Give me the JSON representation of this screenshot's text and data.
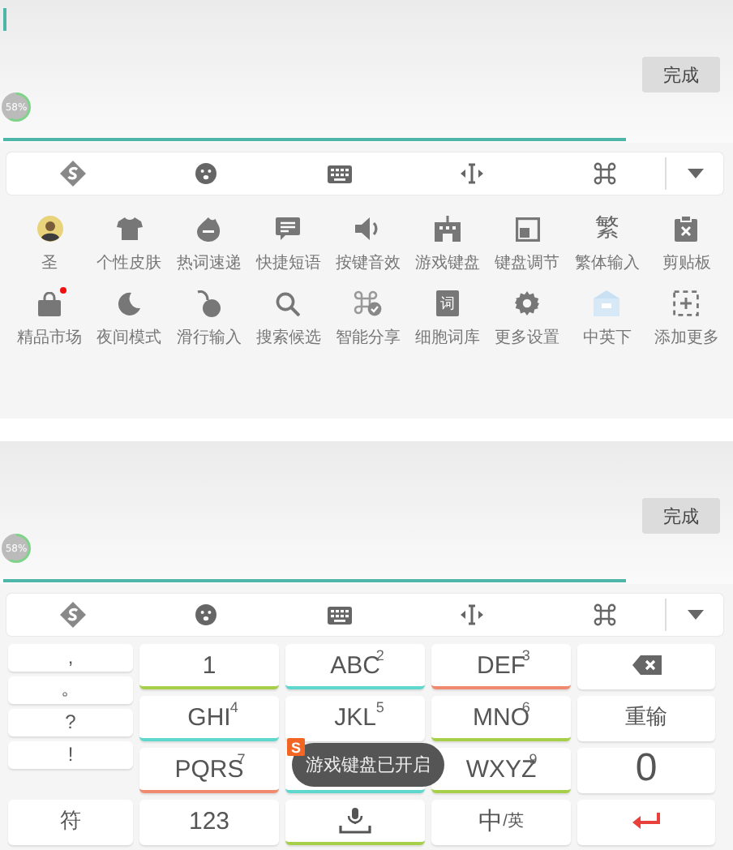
{
  "panels": [
    {
      "kind": "functions",
      "editor": {
        "cursor": true,
        "done_button": "完成",
        "progress": {
          "text": "58%"
        }
      },
      "functions": [
        {
          "label": "圣",
          "new_dot": false
        },
        {
          "label": "个性皮肤",
          "new_dot": false
        },
        {
          "label": "热词速递",
          "new_dot": false
        },
        {
          "label": "快捷短语",
          "new_dot": false
        },
        {
          "label": "按键音效",
          "new_dot": false
        },
        {
          "label": "游戏键盘",
          "new_dot": false
        },
        {
          "label": "键盘调节",
          "new_dot": false
        },
        {
          "label": "繁体输入",
          "glyph": "繁",
          "new_dot": false
        },
        {
          "label": "剪贴板",
          "new_dot": false
        },
        {
          "label": "精品市场",
          "new_dot": true
        },
        {
          "label": "夜间模式",
          "new_dot": false
        },
        {
          "label": "滑行输入",
          "new_dot": false
        },
        {
          "label": "搜索候选",
          "new_dot": false
        },
        {
          "label": "智能分享",
          "new_dot": false
        },
        {
          "label": "细胞词库",
          "glyph": "词",
          "new_dot": false
        },
        {
          "label": "更多设置",
          "new_dot": false
        },
        {
          "label": "中英下",
          "new_dot": false
        },
        {
          "label": "添加更多",
          "new_dot": false
        }
      ]
    },
    {
      "kind": "keyboard",
      "editor": {
        "cursor": false,
        "done_button": "完成",
        "progress": {
          "text": "58%"
        }
      },
      "left_keys": [
        ",",
        "。",
        "?",
        "!"
      ],
      "symbol_key": "符",
      "keys": [
        {
          "kind": "letters",
          "label": "1",
          "color": "#a6cf4a"
        },
        {
          "kind": "letters",
          "label": "ABC",
          "digit": "2",
          "color": "#5ed8cf"
        },
        {
          "kind": "letters",
          "label": "DEF",
          "digit": "3",
          "color": "#f08a6e"
        },
        {
          "kind": "delete"
        },
        {
          "kind": "letters",
          "label": "GHI",
          "digit": "4",
          "color": "#5ed8cf"
        },
        {
          "kind": "letters",
          "label": "JKL",
          "digit": "5",
          "color": "#ffffff"
        },
        {
          "kind": "letters",
          "label": "MNO",
          "digit": "6",
          "color": "#a6cf4a"
        },
        {
          "kind": "text",
          "label": "重输"
        },
        {
          "kind": "letters",
          "label": "PQRS",
          "digit": "7",
          "color": "#f08a6e"
        },
        {
          "kind": "letters",
          "color": "#5ed8cf"
        },
        {
          "kind": "letters",
          "label": "WXYZ",
          "digit": "9",
          "color": "#a6cf4a"
        },
        {
          "kind": "big",
          "label": "0"
        },
        {
          "kind": "letters",
          "label": "123",
          "color": "#ffffff"
        },
        {
          "kind": "mic",
          "color": "#a6cf4a"
        },
        {
          "kind": "lang",
          "label": "中",
          "sub": "/英"
        },
        {
          "kind": "enter"
        }
      ],
      "toast": {
        "badge": "S",
        "text": "游戏键盘已开启"
      }
    }
  ]
}
